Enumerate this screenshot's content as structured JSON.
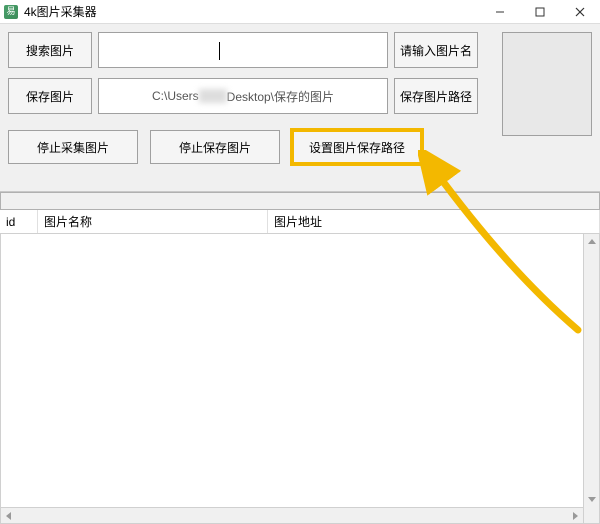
{
  "window": {
    "title": "4k图片采集器",
    "app_icon_glyph": "易"
  },
  "toolbar": {
    "search_button": "搜索图片",
    "search_value": "",
    "input_name_button": "请输入图片名",
    "save_button": "保存图片",
    "save_path_prefix": "C:\\Users",
    "save_path_blur": "xxxx",
    "save_path_suffix": "Desktop\\保存的图片",
    "path_button": "保存图片路径",
    "stop_collect_button": "停止采集图片",
    "stop_save_button": "停止保存图片",
    "set_path_button": "设置图片保存路径"
  },
  "table": {
    "col_id": "id",
    "col_name": "图片名称",
    "col_url": "图片地址",
    "rows": []
  },
  "colors": {
    "highlight": "#f3b800",
    "arrow": "#f3b800"
  }
}
